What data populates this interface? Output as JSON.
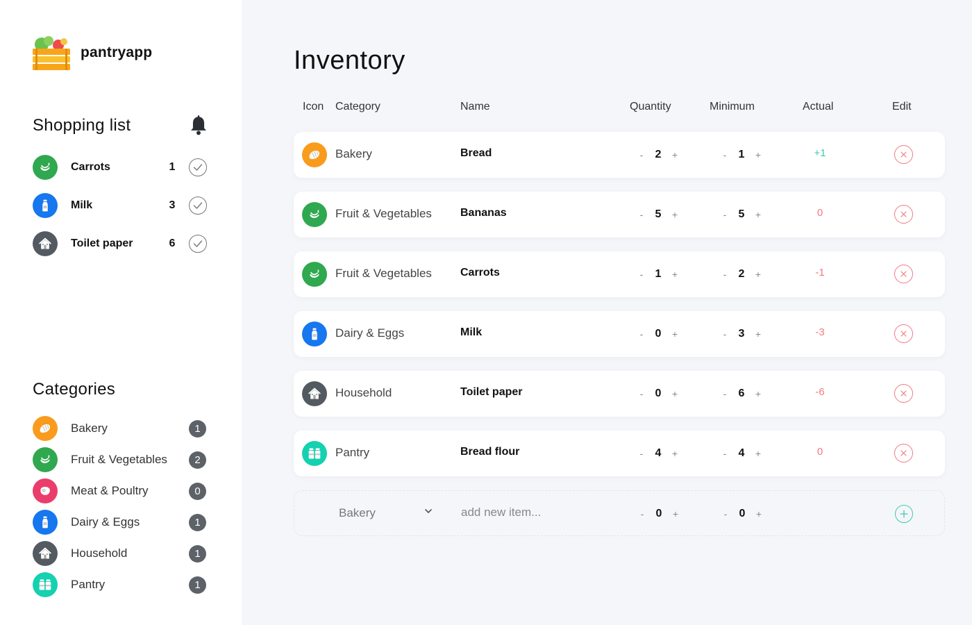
{
  "app": {
    "name": "pantryapp"
  },
  "colors": {
    "bakery": "#f99b1c",
    "fruit": "#2fa84f",
    "meat": "#ea3d6b",
    "dairy": "#1677ee",
    "household": "#545a62",
    "pantry": "#14d1b0",
    "positive": "#3fc9b0",
    "negative": "#f27a80"
  },
  "shopping_list": {
    "title": "Shopping list",
    "items": [
      {
        "name": "Carrots",
        "qty": "1",
        "icon": "banana-icon",
        "color": "#2fa84f"
      },
      {
        "name": "Milk",
        "qty": "3",
        "icon": "milk-bottle-icon",
        "color": "#1677ee"
      },
      {
        "name": "Toilet paper",
        "qty": "6",
        "icon": "house-icon",
        "color": "#545a62"
      }
    ]
  },
  "categories": {
    "title": "Categories",
    "items": [
      {
        "name": "Bakery",
        "count": "1",
        "icon": "croissant-icon",
        "color": "#f99b1c"
      },
      {
        "name": "Fruit & Vegetables",
        "count": "2",
        "icon": "banana-icon",
        "color": "#2fa84f"
      },
      {
        "name": "Meat & Poultry",
        "count": "0",
        "icon": "steak-icon",
        "color": "#ea3d6b"
      },
      {
        "name": "Dairy & Eggs",
        "count": "1",
        "icon": "milk-bottle-icon",
        "color": "#1677ee"
      },
      {
        "name": "Household",
        "count": "1",
        "icon": "house-icon",
        "color": "#545a62"
      },
      {
        "name": "Pantry",
        "count": "1",
        "icon": "jars-icon",
        "color": "#14d1b0"
      }
    ]
  },
  "inventory": {
    "title": "Inventory",
    "columns": {
      "icon": "Icon",
      "category": "Category",
      "name": "Name",
      "quantity": "Quantity",
      "minimum": "Minimum",
      "actual": "Actual",
      "edit": "Edit"
    },
    "rows": [
      {
        "category": "Bakery",
        "name": "Bread",
        "quantity": "2",
        "minimum": "1",
        "actual": "+1",
        "icon": "croissant-icon",
        "color": "#f99b1c"
      },
      {
        "category": "Fruit & Vegetables",
        "name": "Bananas",
        "quantity": "5",
        "minimum": "5",
        "actual": "0",
        "icon": "banana-icon",
        "color": "#2fa84f"
      },
      {
        "category": "Fruit & Vegetables",
        "name": "Carrots",
        "quantity": "1",
        "minimum": "2",
        "actual": "-1",
        "icon": "banana-icon",
        "color": "#2fa84f"
      },
      {
        "category": "Dairy & Eggs",
        "name": "Milk",
        "quantity": "0",
        "minimum": "3",
        "actual": "-3",
        "icon": "milk-bottle-icon",
        "color": "#1677ee"
      },
      {
        "category": "Household",
        "name": "Toilet paper",
        "quantity": "0",
        "minimum": "6",
        "actual": "-6",
        "icon": "house-icon",
        "color": "#545a62"
      },
      {
        "category": "Pantry",
        "name": "Bread flour",
        "quantity": "4",
        "minimum": "4",
        "actual": "0",
        "icon": "jars-icon",
        "color": "#14d1b0"
      }
    ],
    "new_item": {
      "category": "Bakery",
      "placeholder": "add new item...",
      "quantity": "0",
      "minimum": "0"
    },
    "stepper": {
      "minus": "-",
      "plus": "+"
    }
  }
}
